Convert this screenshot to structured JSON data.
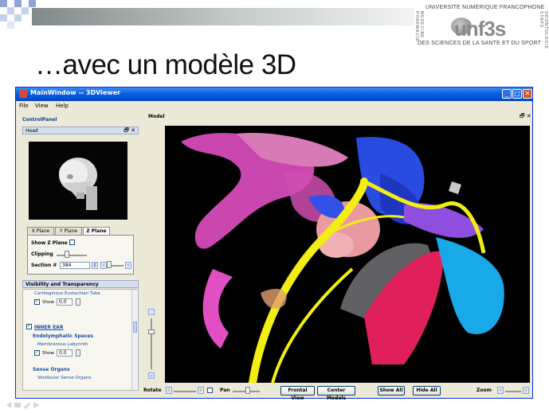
{
  "slide": {
    "title": "…avec un modèle 3D",
    "logo": {
      "line1": "UNIVERSITE NUMERIQUE FRANCOPHONE",
      "brand": "unf3s",
      "line2": "DES SCIENCES DE LA SANTE ET DU SPORT",
      "left_vertical": "MEDECINE PHARMACIE",
      "right_vertical": "ODONTOLOGIE STAPS"
    }
  },
  "window": {
    "title": "MainWindow -- 3DViewer",
    "buttons": {
      "minimize": "_",
      "maximize": "□",
      "close": "✕"
    },
    "menu": [
      "File",
      "View",
      "Help"
    ]
  },
  "control_panel": {
    "label": "ControlPanel",
    "head_panel": {
      "title": "Head",
      "dock_icons": "🗗 ✕"
    },
    "tabs": [
      "X Plane",
      "Y Plane",
      "Z Plane"
    ],
    "active_tab": "Z Plane",
    "z_plane": {
      "show_label": "Show Z Plane",
      "clipping_label": "Clipping",
      "section_label": "Section #",
      "section_value": "384",
      "clipping_level": 0.35,
      "section_slider_level": 0.1
    },
    "visibility": {
      "title": "Visibility and Transparency",
      "dock_icons": "🗗 ✕",
      "rows": [
        {
          "text": "Cartilaginous Eustachian Tube",
          "kind": "item"
        },
        {
          "text": "Show",
          "value": "0,0",
          "kind": "show"
        },
        {
          "text": "INNER EAR",
          "kind": "section"
        },
        {
          "text": "Endolymphatic Spaces",
          "kind": "sub"
        },
        {
          "text": "Membranous Labyrinth",
          "kind": "item"
        },
        {
          "text": "Show",
          "value": "0,0",
          "kind": "show"
        },
        {
          "text": "Sense Organs",
          "kind": "sub"
        },
        {
          "text": "Vestibular Sense Organs",
          "kind": "item"
        }
      ]
    }
  },
  "model_panel": {
    "label": "Model",
    "dock_icons": "🗗 ✕"
  },
  "bottom_bar": {
    "rotate_label": "Rotate",
    "pan_label": "Pan",
    "zoom_label": "Zoom",
    "buttons": [
      "Frontal View",
      "Center Models",
      "Show All",
      "Hide All"
    ]
  },
  "colors": {
    "title_bar": "#0a5fe0",
    "window_bg": "#ece9d8",
    "viewport_bg": "#000000",
    "nerve_yellow": "#f2ee14",
    "tissue_magenta": "#e040c8",
    "vessel_blue": "#2a4be0",
    "artery_red": "#e0205a",
    "cyan_structure": "#19a8e8"
  }
}
